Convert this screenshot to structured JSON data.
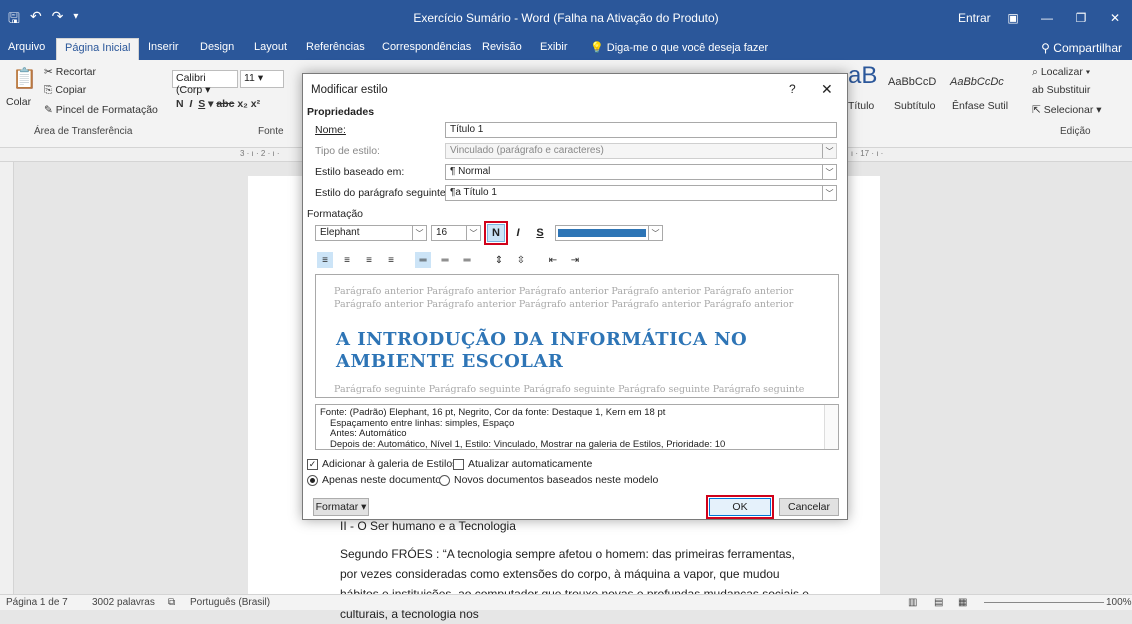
{
  "titlebar": {
    "title": "Exercício Sumário - Word (Falha na Ativação do Produto)",
    "signin": "Entrar",
    "qat": [
      "save-icon",
      "undo-icon",
      "redo-icon",
      "customize-icon"
    ]
  },
  "tabs": [
    "Arquivo",
    "Página Inicial",
    "Inserir",
    "Design",
    "Layout",
    "Referências",
    "Correspondências",
    "Revisão",
    "Exibir"
  ],
  "tell_me": "Diga-me o que você deseja fazer",
  "share": "Compartilhar",
  "ribbon": {
    "clipboard": {
      "paste": "Colar",
      "cut": "Recortar",
      "copy": "Copiar",
      "format_painter": "Pincel de Formatação",
      "label": "Área de Transferência"
    },
    "font": {
      "name": "Calibri (Corp",
      "size": "11",
      "label": "Fonte"
    },
    "styles": [
      {
        "preview": "AaBbCcD",
        "name": "Título"
      },
      {
        "preview": "AaBbCcD",
        "name": "Subtítulo"
      },
      {
        "preview": "AaBbCcDc",
        "name": "Ênfase Sutil"
      }
    ],
    "styles_big": "aB",
    "editing": {
      "find": "Localizar",
      "replace": "Substituir",
      "select": "Selecionar",
      "label": "Edição"
    }
  },
  "ruler": {
    "left_mark": "3 · ı · 2 · ı ·",
    "right_mark": "· ı · 17 · ı ·"
  },
  "document": {
    "heading": "II - O Ser humano e a Tecnologia",
    "paragraph": "Segundo FRÓES : “A tecnologia sempre afetou o homem: das primeiras ferramentas, por vezes consideradas como extensões do corpo, à máquina a vapor, que mudou hábitos e instituições, ao computador que trouxe novas e profundas mudanças sociais e culturais, a tecnologia nos"
  },
  "statusbar": {
    "page": "Página 1 de 7",
    "words": "3002 palavras",
    "language": "Português (Brasil)",
    "zoom": "100%"
  },
  "dialog": {
    "title": "Modificar estilo",
    "help": "?",
    "close": "✕",
    "properties_section": "Propriedades",
    "name_label": "Nome:",
    "name_value": "Título 1",
    "type_label": "Tipo de estilo:",
    "type_value": "Vinculado (parágrafo e caracteres)",
    "based_label": "Estilo baseado em:",
    "based_value": "¶ Normal",
    "next_label": "Estilo do parágrafo seguinte:",
    "next_value": "¶a Título 1",
    "formatting_section": "Formatação",
    "font_value": "Elephant",
    "size_value": "16",
    "bold": "N",
    "italic": "I",
    "underline": "S",
    "font_color": "#2e75b6",
    "preview_prev": "Parágrafo anterior Parágrafo anterior Parágrafo anterior Parágrafo anterior Parágrafo anterior Parágrafo anterior Parágrafo anterior Parágrafo anterior Parágrafo anterior Parágrafo anterior",
    "preview_heading": "A INTRODUÇÃO DA INFORMÁTICA NO AMBIENTE ESCOLAR",
    "preview_next": "Parágrafo seguinte Parágrafo seguinte Parágrafo seguinte Parágrafo seguinte Parágrafo seguinte",
    "desc_lines": [
      "Fonte: (Padrão) Elephant, 16 pt, Negrito, Cor da fonte: Destaque 1, Kern em 18 pt",
      "Espaçamento entre linhas:  simples, Espaço",
      "Antes:  Automático",
      "Depois de:  Automático, Nível 1, Estilo: Vinculado, Mostrar na galeria de Estilos, Prioridade: 10"
    ],
    "add_gallery": "Adicionar à galeria de Estilos",
    "auto_update": "Atualizar automaticamente",
    "only_doc": "Apenas neste documento",
    "new_docs": "Novos documentos baseados neste modelo",
    "format_btn": "Formatar ▾",
    "ok": "OK",
    "cancel": "Cancelar"
  }
}
